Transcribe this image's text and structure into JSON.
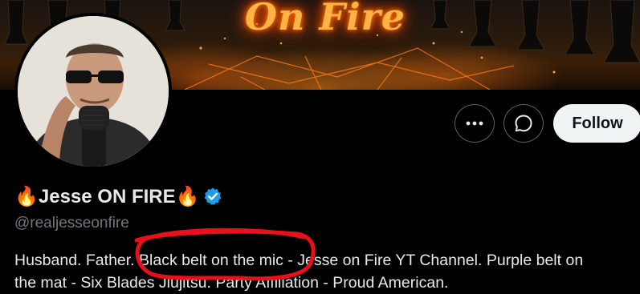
{
  "banner": {
    "title": "On Fire"
  },
  "profile": {
    "name": "🔥Jesse ON FIRE🔥",
    "handle": "@realjesseonfire",
    "verified": true,
    "bio_line1": "Husband. Father. Black belt on the mic - Jesse on Fire YT Channel. Purple belt on",
    "bio_line2": "the mat - Six Blades Jiujitsu. Party Affiliation - Proud American."
  },
  "actions": {
    "more_icon": "more-horizontal-icon",
    "message_icon": "message-bubble-icon",
    "follow_label": "Follow"
  },
  "colors": {
    "background": "#000000",
    "text": "#e7e9ea",
    "secondary_text": "#71767b",
    "verified_blue": "#1d9bf0",
    "button_border": "#536471",
    "follow_bg": "#eff3f4",
    "annotation_red": "#e8101b"
  }
}
